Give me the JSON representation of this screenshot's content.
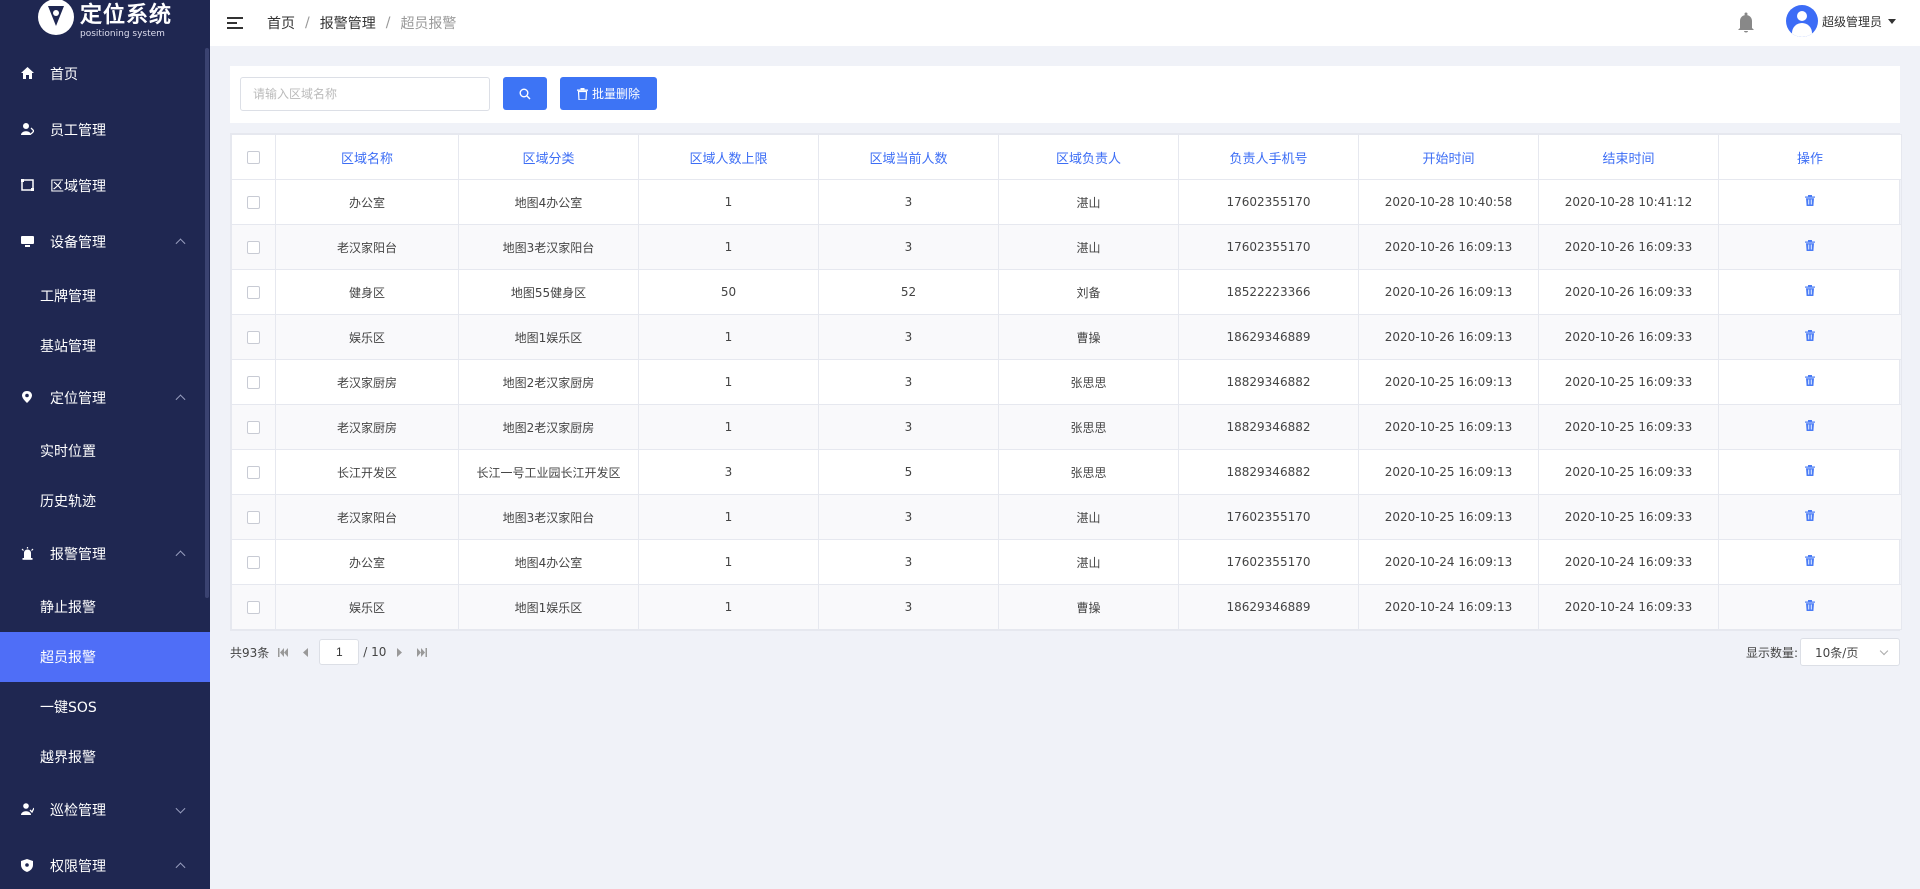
{
  "app": {
    "logo_title": "定位系统",
    "logo_subtitle": "positioning system"
  },
  "sidebar": {
    "items": [
      {
        "label": "首页",
        "icon": "home-icon"
      },
      {
        "label": "员工管理",
        "icon": "employee-icon"
      },
      {
        "label": "区域管理",
        "icon": "area-icon"
      },
      {
        "label": "设备管理",
        "icon": "device-icon",
        "expanded": true
      },
      {
        "label": "工牌管理"
      },
      {
        "label": "基站管理"
      },
      {
        "label": "定位管理",
        "icon": "location-pin-icon",
        "expanded": true
      },
      {
        "label": "实时位置"
      },
      {
        "label": "历史轨迹"
      },
      {
        "label": "报警管理",
        "icon": "alarm-icon",
        "expanded": true
      },
      {
        "label": "静止报警"
      },
      {
        "label": "超员报警",
        "active": true
      },
      {
        "label": "一键SOS"
      },
      {
        "label": "越界报警"
      },
      {
        "label": "巡检管理",
        "icon": "patrol-icon",
        "expanded": false
      },
      {
        "label": "权限管理",
        "icon": "shield-icon",
        "expanded": true
      }
    ]
  },
  "header": {
    "breadcrumb": [
      "首页",
      "报警管理",
      "超员报警"
    ],
    "user_name": "超级管理员"
  },
  "toolbar": {
    "search_placeholder": "请输入区域名称",
    "search_value": "",
    "batch_delete_label": "批量删除"
  },
  "table": {
    "columns": [
      "区域名称",
      "区域分类",
      "区域人数上限",
      "区域当前人数",
      "区域负责人",
      "负责人手机号",
      "开始时间",
      "结束时间",
      "操作"
    ],
    "rows": [
      [
        "办公室",
        "地图4办公室",
        "1",
        "3",
        "湛山",
        "17602355170",
        "2020-10-28 10:40:58",
        "2020-10-28 10:41:12"
      ],
      [
        "老汉家阳台",
        "地图3老汉家阳台",
        "1",
        "3",
        "湛山",
        "17602355170",
        "2020-10-26 16:09:13",
        "2020-10-26 16:09:33"
      ],
      [
        "健身区",
        "地图55健身区",
        "50",
        "52",
        "刘备",
        "18522223366",
        "2020-10-26 16:09:13",
        "2020-10-26 16:09:33"
      ],
      [
        "娱乐区",
        "地图1娱乐区",
        "1",
        "3",
        "曹操",
        "18629346889",
        "2020-10-26 16:09:13",
        "2020-10-26 16:09:33"
      ],
      [
        "老汉家厨房",
        "地图2老汉家厨房",
        "1",
        "3",
        "张思思",
        "18829346882",
        "2020-10-25 16:09:13",
        "2020-10-25 16:09:33"
      ],
      [
        "老汉家厨房",
        "地图2老汉家厨房",
        "1",
        "3",
        "张思思",
        "18829346882",
        "2020-10-25 16:09:13",
        "2020-10-25 16:09:33"
      ],
      [
        "长江开发区",
        "长江一号工业园长江开发区",
        "3",
        "5",
        "张思思",
        "18829346882",
        "2020-10-25 16:09:13",
        "2020-10-25 16:09:33"
      ],
      [
        "老汉家阳台",
        "地图3老汉家阳台",
        "1",
        "3",
        "湛山",
        "17602355170",
        "2020-10-25 16:09:13",
        "2020-10-25 16:09:33"
      ],
      [
        "办公室",
        "地图4办公室",
        "1",
        "3",
        "湛山",
        "17602355170",
        "2020-10-24 16:09:13",
        "2020-10-24 16:09:33"
      ],
      [
        "娱乐区",
        "地图1娱乐区",
        "1",
        "3",
        "曹操",
        "18629346889",
        "2020-10-24 16:09:13",
        "2020-10-24 16:09:33"
      ]
    ]
  },
  "pagination": {
    "total_label": "共93条",
    "current_page": "1",
    "total_pages_label": "/ 10",
    "page_size_label": "显示数量:",
    "page_size_value": "10条/页"
  },
  "colors": {
    "sidebar_bg": "#1f2751",
    "active_item": "#4f6ef7",
    "primary": "#3d74f5",
    "header_text": "#3d6ef5",
    "page_bg": "#f0f2f8"
  }
}
